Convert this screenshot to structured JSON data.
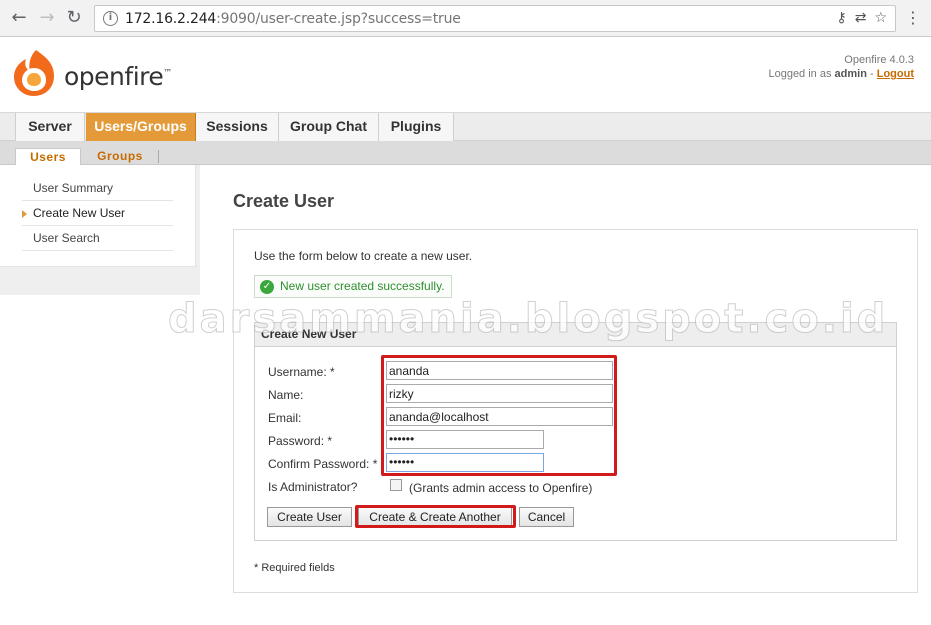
{
  "browser": {
    "url_host": "172.16.2.244",
    "url_rest": ":9090/user-create.jsp?success=true"
  },
  "header": {
    "logo_text": "openfire",
    "version": "Openfire 4.0.3",
    "logged_in_prefix": "Logged in as",
    "user": "admin",
    "separator": "-",
    "logout": "Logout"
  },
  "main_tabs": [
    {
      "label": "Server"
    },
    {
      "label": "Users/Groups"
    },
    {
      "label": "Sessions"
    },
    {
      "label": "Group Chat"
    },
    {
      "label": "Plugins"
    }
  ],
  "sub_tabs": [
    {
      "label": "Users"
    },
    {
      "label": "Groups"
    }
  ],
  "sidebar": {
    "items": [
      {
        "label": "User Summary"
      },
      {
        "label": "Create New User"
      },
      {
        "label": "User Search"
      }
    ]
  },
  "page": {
    "title": "Create User",
    "intro": "Use the form below to create a new user.",
    "success_message": "New user created successfully.",
    "required_note": "* Required fields"
  },
  "form": {
    "header": "Create New User",
    "fields": [
      {
        "label": "Username: *",
        "value": "ananda"
      },
      {
        "label": "Name:",
        "value": "rizky"
      },
      {
        "label": "Email:",
        "value": "ananda@localhost"
      },
      {
        "label": "Password: *",
        "value": "••••••"
      },
      {
        "label": "Confirm Password: *",
        "value": "••••••"
      }
    ],
    "admin_label": "Is Administrator?",
    "admin_checkbox_label": "(Grants admin access to Openfire)",
    "admin_checked": false,
    "buttons": {
      "create": "Create User",
      "create_another": "Create & Create Another",
      "cancel": "Cancel"
    }
  },
  "watermark": "darsammania.blogspot.co.id",
  "colors": {
    "accent_orange": "#e59a3a",
    "link_orange": "#c66b00",
    "success_green": "#2f8f2f",
    "highlight_red": "#d11a1a"
  }
}
